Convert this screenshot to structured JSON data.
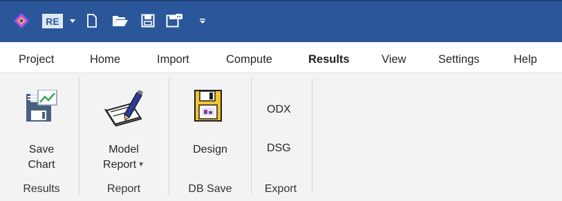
{
  "quick_access": {
    "app_badge": "RE",
    "icons": [
      "app-logo-icon",
      "re-icon",
      "dropdown-arrow-icon",
      "new-file-icon",
      "open-folder-icon",
      "save-icon",
      "save-as-icon",
      "customize-toolbar-icon"
    ],
    "accent_color": "#2b579a"
  },
  "tabs": {
    "project": "Project",
    "home": "Home",
    "import": "Import",
    "compute": "Compute",
    "results": "Results",
    "view": "View",
    "settings": "Settings",
    "help": "Help",
    "active": "Results"
  },
  "ribbon": {
    "results_group": {
      "label": "Results",
      "save_chart_line1": "Save",
      "save_chart_line2": "Chart",
      "save_chart_icon": "save-chart-icon"
    },
    "report_group": {
      "label": "Report",
      "model_report_line1": "Model",
      "model_report_line2": "Report",
      "model_report_icon": "notebook-pen-icon"
    },
    "db_save_group": {
      "label": "DB Save",
      "design_label": "Design",
      "design_icon": "floppy-disk-icon"
    },
    "export_group": {
      "label": "Export",
      "odx_label": "ODX",
      "dsg_label": "DSG"
    }
  }
}
